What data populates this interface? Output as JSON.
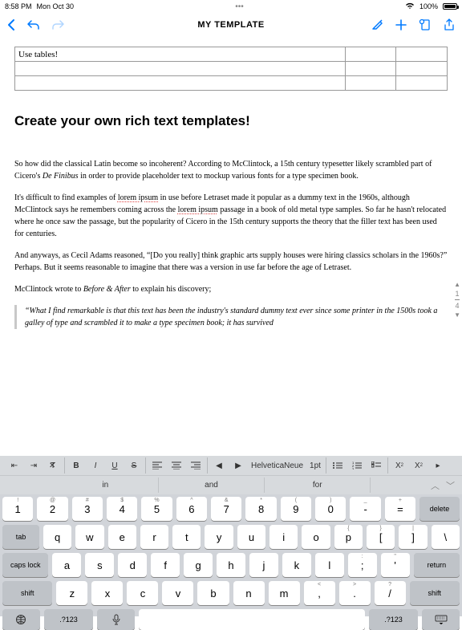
{
  "status": {
    "time": "8:58 PM",
    "date": "Mon Oct 30",
    "battery_pct": "100%"
  },
  "nav": {
    "title": "MY TEMPLATE"
  },
  "doc": {
    "table_cell": "Use tables!",
    "heading": "Create your own rich text templates!",
    "p1a": "So how did the classical Latin become so incoherent? According to McClintock, a 15th century typesetter likely scrambled part of Cicero's ",
    "p1b": "De Finibus",
    "p1c": " in order to provide placeholder text to mockup various fonts for a type specimen book.",
    "p2a": "It's difficult to find examples of ",
    "p2b": "lorem ipsum",
    "p2c": " in use before Letraset made it popular as a dummy text in the 1960s, although McClintock says he remembers coming across the ",
    "p2d": "lorem ipsum",
    "p2e": " passage in a book of old metal type samples. So far he hasn't relocated where he once saw the passage, but the popularity of Cicero in the 15th century supports the theory that the filler text has been used for centuries.",
    "p3": "And anyways, as Cecil Adams reasoned, “[Do you really] think graphic arts supply houses were hiring classics scholars in the 1960s?” Perhaps. But it seems reasonable to imagine that there was a version in use far before the age of Letraset.",
    "p4a": "McClintock wrote to ",
    "p4b": "Before & After",
    "p4c": " to explain his discovery;",
    "q1": "“What I find remarkable is that this text has been the industry's standard dummy text ever since some printer in the 1500s took a galley of type and scrambled it to make a type specimen book; it has survived"
  },
  "page_indicator": {
    "up": "▲",
    "cur": "1",
    "total": "4",
    "down": "▼"
  },
  "fmt": {
    "font": "HelveticaNeue",
    "size": "1pt",
    "B": "B",
    "I": "I",
    "U": "U",
    "S": "S",
    "sup": "X",
    "sup2": "2",
    "sub": "X",
    "sub2": "2"
  },
  "sugg": {
    "a": "in",
    "b": "and",
    "c": "for"
  },
  "kbd": {
    "r1_alt": [
      "!",
      "@",
      "#",
      "$",
      "%",
      "^",
      "&",
      "*",
      "(",
      ")",
      "_",
      "+"
    ],
    "r1": [
      "1",
      "2",
      "3",
      "4",
      "5",
      "6",
      "7",
      "8",
      "9",
      "0",
      "-",
      "="
    ],
    "delete": "delete",
    "tab": "tab",
    "r2_alt": [
      "",
      "",
      "",
      "",
      "",
      "",
      "",
      "",
      "",
      "{",
      "}",
      "|"
    ],
    "r2": [
      "q",
      "w",
      "e",
      "r",
      "t",
      "y",
      "u",
      "i",
      "o",
      "p",
      "[",
      "]",
      "\\"
    ],
    "caps": "caps lock",
    "r3_alt": [
      "",
      "",
      "",
      "",
      "",
      "",
      "",
      "",
      "",
      ":",
      "\""
    ],
    "r3": [
      "a",
      "s",
      "d",
      "f",
      "g",
      "h",
      "j",
      "k",
      "l",
      ";",
      "'"
    ],
    "return": "return",
    "shift": "shift",
    "r4_alt": [
      "",
      "",
      "",
      "",
      "",
      "",
      "",
      "<",
      ">",
      "?"
    ],
    "r4": [
      "z",
      "x",
      "c",
      "v",
      "b",
      "n",
      "m",
      ",",
      ".",
      "/"
    ],
    "sym": ".?123"
  }
}
